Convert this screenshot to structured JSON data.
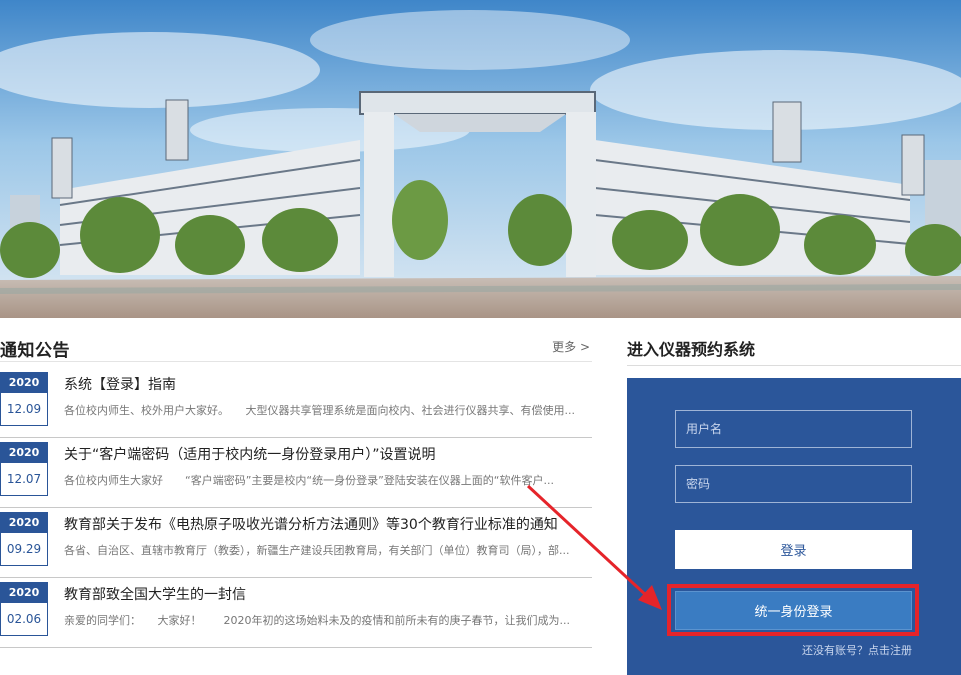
{
  "notices": {
    "title": "通知公告",
    "more": "更多 >",
    "items": [
      {
        "year": "2020",
        "md": "12.09",
        "title": "系统【登录】指南",
        "summary": "各位校内师生、校外用户大家好。　　大型仪器共享管理系统是面向校内、社会进行仪器共享、有偿使用..."
      },
      {
        "year": "2020",
        "md": "12.07",
        "title": "关于“客户端密码（适用于校内统一身份登录用户）”设置说明",
        "summary": "各位校内师生大家好　　“客户端密码”主要是校内“统一身份登录”登陆安装在仪器上面的“软件客户..."
      },
      {
        "year": "2020",
        "md": "09.29",
        "title": "教育部关于发布《电热原子吸收光谱分析方法通则》等30个教育行业标准的通知",
        "summary": " 各省、自治区、直辖市教育厅（教委），新疆生产建设兵团教育局，有关部门（单位）教育司（局），部..."
      },
      {
        "year": "2020",
        "md": "02.06",
        "title": "教育部致全国大学生的一封信",
        "summary": "亲爱的同学们：　　大家好！　　2020年初的这场始料未及的疫情和前所未有的庚子春节，让我们成为..."
      }
    ]
  },
  "login": {
    "heading": "进入仪器预约系统",
    "username_placeholder": "用户名",
    "password_placeholder": "密码",
    "login_button": "登录",
    "sso_button": "统一身份登录",
    "no_account": "还没有账号？",
    "register": "点击注册"
  },
  "colors": {
    "brand_blue": "#2b569a",
    "sso_blue": "#3a7cc2",
    "highlight_red": "#e5242a"
  },
  "icons": {
    "annotation_arrow": "red-arrow-icon"
  }
}
